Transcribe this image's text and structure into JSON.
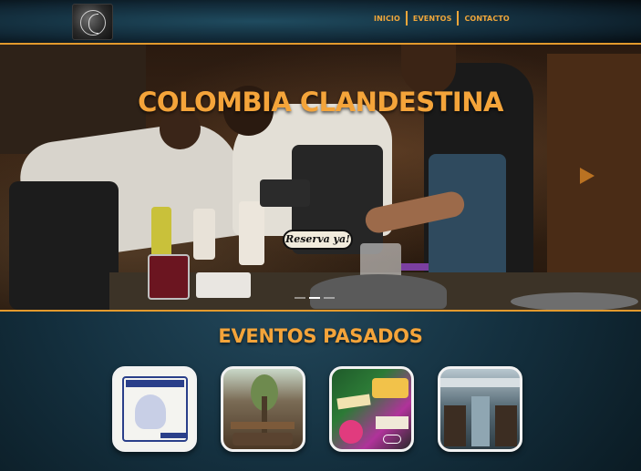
{
  "header": {
    "logo_alt": "Colombia Clandestina logo",
    "nav": [
      "INICIO",
      "EVENTOS",
      "CONTACTO"
    ]
  },
  "hero": {
    "title": "COLOMBIA CLANDESTINA",
    "cta_label": "Reserva ya!",
    "slides_count": 3,
    "active_slide": 2
  },
  "events": {
    "title": "EVENTOS PASADOS",
    "thumbnails": [
      "event-1",
      "event-2",
      "event-3",
      "event-4"
    ]
  },
  "colors": {
    "accent": "#f4a43a",
    "background": "#14303f"
  }
}
